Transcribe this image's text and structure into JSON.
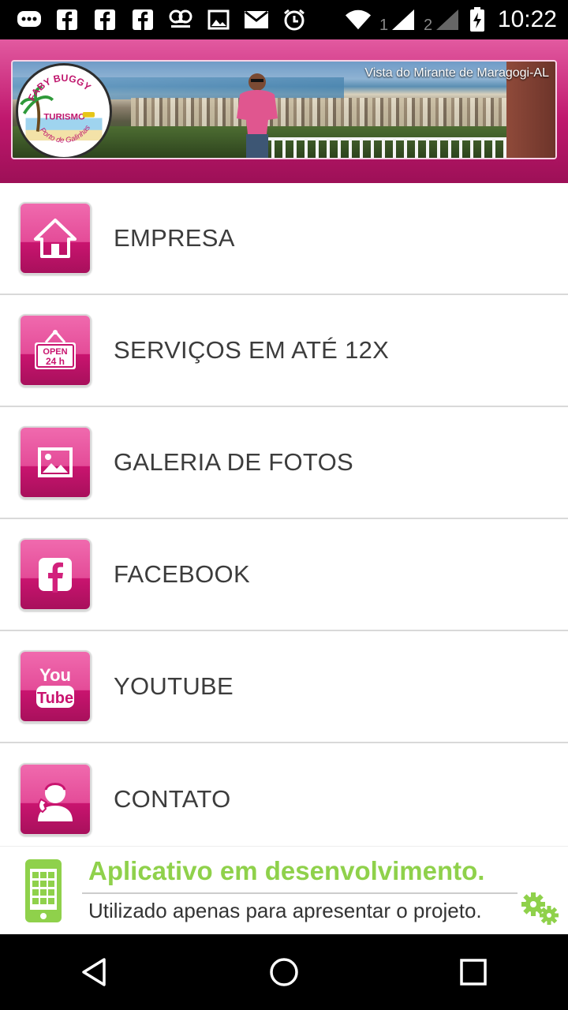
{
  "status_bar": {
    "time": "10:22",
    "left_icons": [
      "chat-icon",
      "facebook-icon",
      "facebook-icon",
      "facebook-icon",
      "voicemail-icon",
      "image-icon",
      "mail-icon",
      "alarm-icon"
    ],
    "right_icons": [
      "wifi-icon",
      "signal-sim1-icon",
      "signal-sim2-icon",
      "battery-charging-icon"
    ],
    "sim1": "1",
    "sim2": "2"
  },
  "header": {
    "caption": "Vista do Mirante de Maragogi-AL",
    "logo": {
      "top_text": "FABY BUGGY",
      "middle_text": "TURISMO",
      "bottom_text": "Porto de Galinhas"
    }
  },
  "menu": {
    "items": [
      {
        "label": "EMPRESA",
        "icon": "home-icon"
      },
      {
        "label": "SERVIÇOS EM ATÉ 12X",
        "icon": "open-24h-sign-icon"
      },
      {
        "label": "GALERIA DE FOTOS",
        "icon": "picture-icon"
      },
      {
        "label": "FACEBOOK",
        "icon": "facebook-icon"
      },
      {
        "label": "YOUTUBE",
        "icon": "youtube-icon"
      },
      {
        "label": "CONTATO",
        "icon": "contact-person-icon"
      }
    ],
    "open_sign": {
      "line1": "OPEN",
      "line2": "24 h"
    },
    "youtube_icon": {
      "line1": "You",
      "line2": "Tube"
    }
  },
  "dev_banner": {
    "title": "Aplicativo em desenvolvimento.",
    "subtitle": "Utilizado apenas para apresentar o projeto."
  },
  "nav_bar": {
    "buttons": [
      "back-icon",
      "home-circle-icon",
      "recents-icon"
    ]
  },
  "colors": {
    "header_pink": "#c0186e",
    "icon_pink": "#e44c98",
    "dev_green": "#8fd14b",
    "label_gray": "#3c3c3c"
  }
}
